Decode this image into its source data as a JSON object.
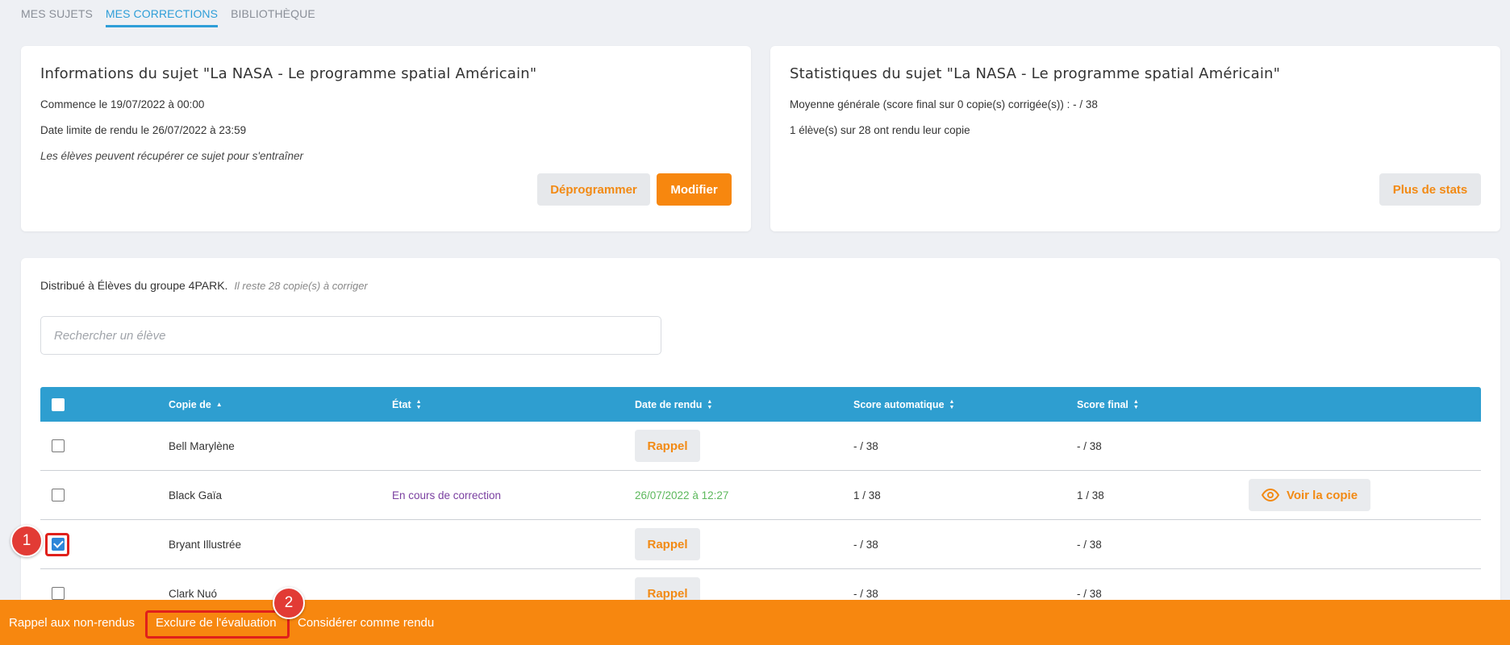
{
  "tabs": [
    {
      "label": "MES SUJETS",
      "active": false
    },
    {
      "label": "MES CORRECTIONS",
      "active": true
    },
    {
      "label": "BIBLIOTHÈQUE",
      "active": false
    }
  ],
  "info": {
    "title": "Informations du sujet \"La NASA - Le programme spatial Américain\"",
    "start": "Commence le 19/07/2022 à 00:00",
    "deadline": "Date limite de rendu le  26/07/2022 à 23:59",
    "note": "Les élèves peuvent récupérer ce sujet pour s'entraîner",
    "btn_unschedule": "Déprogrammer",
    "btn_edit": "Modifier"
  },
  "stats": {
    "title": "Statistiques du sujet \"La NASA - Le programme spatial Américain\"",
    "average": "Moyenne générale (score final sur 0 copie(s) corrigée(s)) : - / 38",
    "submitted": "1 élève(s) sur 28 ont rendu leur copie",
    "btn_more": "Plus de stats"
  },
  "main": {
    "distributed": "Distribué à Élèves du groupe 4PARK.",
    "remaining": "Il reste 28 copie(s) à corriger",
    "search_placeholder": "Rechercher un élève"
  },
  "table": {
    "headers": {
      "copy_of": "Copie de",
      "state": "État",
      "date": "Date de rendu",
      "auto_score": "Score automatique",
      "final_score": "Score final"
    },
    "rows": [
      {
        "name": "Bell Marylène",
        "state": "",
        "date": "",
        "rappel": "Rappel",
        "auto": "- / 38",
        "final": "- / 38",
        "checked": false,
        "view": ""
      },
      {
        "name": "Black Gaïa",
        "state": "En cours de correction",
        "date": "26/07/2022 à 12:27",
        "rappel": "",
        "auto": "1 / 38",
        "final": "1 / 38",
        "checked": false,
        "view": "Voir la copie"
      },
      {
        "name": "Bryant Illustrée",
        "state": "",
        "date": "",
        "rappel": "Rappel",
        "auto": "- / 38",
        "final": "- / 38",
        "checked": true,
        "view": ""
      },
      {
        "name": "Clark Nuó",
        "state": "",
        "date": "",
        "rappel": "Rappel",
        "auto": "- / 38",
        "final": "- / 38",
        "checked": false,
        "view": ""
      }
    ]
  },
  "bottom_bar": {
    "remind": "Rappel aux non-rendus",
    "exclude": "Exclure de l'évaluation",
    "consider": "Considérer comme rendu"
  },
  "annotations": {
    "badge1": "1",
    "badge2": "2"
  },
  "colors": {
    "accent": "#f7870f",
    "header_blue": "#2e9ed0",
    "highlight_red": "#e0201b"
  }
}
